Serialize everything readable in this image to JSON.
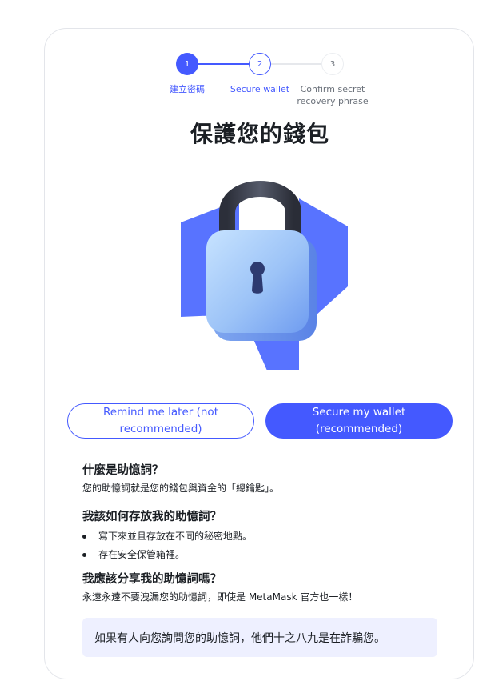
{
  "stepper": {
    "steps": [
      {
        "number": "1",
        "label": "建立密碼",
        "state": "complete"
      },
      {
        "number": "2",
        "label": "Secure wallet",
        "state": "active"
      },
      {
        "number": "3",
        "label": "Confirm secret recovery phrase",
        "state": "upcoming"
      }
    ]
  },
  "page": {
    "title": "保護您的錢包"
  },
  "illustration": {
    "icon": "padlock-icon",
    "colors": {
      "background_shape": "#4f6bff",
      "lock_body": "#8fb7f5",
      "shackle": "#3a3d4a"
    }
  },
  "actions": {
    "remind_later_label": "Remind me later (not recommended)",
    "secure_wallet_label": "Secure my wallet (recommended)"
  },
  "faq": [
    {
      "question": "什麼是助憶詞？",
      "answer": "您的助憶詞就是您的錢包與資金的「總鑰匙」。"
    },
    {
      "question": "我該如何存放我的助憶詞？",
      "bullets": [
        "寫下來並且存放在不同的秘密地點。",
        "存在安全保管箱裡。"
      ]
    },
    {
      "question": "我應該分享我的助憶詞嗎？",
      "answer": "永遠永遠不要洩漏您的助憶詞，即使是 MetaMask 官方也一樣！"
    }
  ],
  "warning": {
    "text": "如果有人向您詢問您的助憶詞，他們十之八九是在詐騙您。"
  },
  "colors": {
    "accent": "#4459ff",
    "warning_bg": "#eef0ff",
    "text": "#1b1f24"
  }
}
